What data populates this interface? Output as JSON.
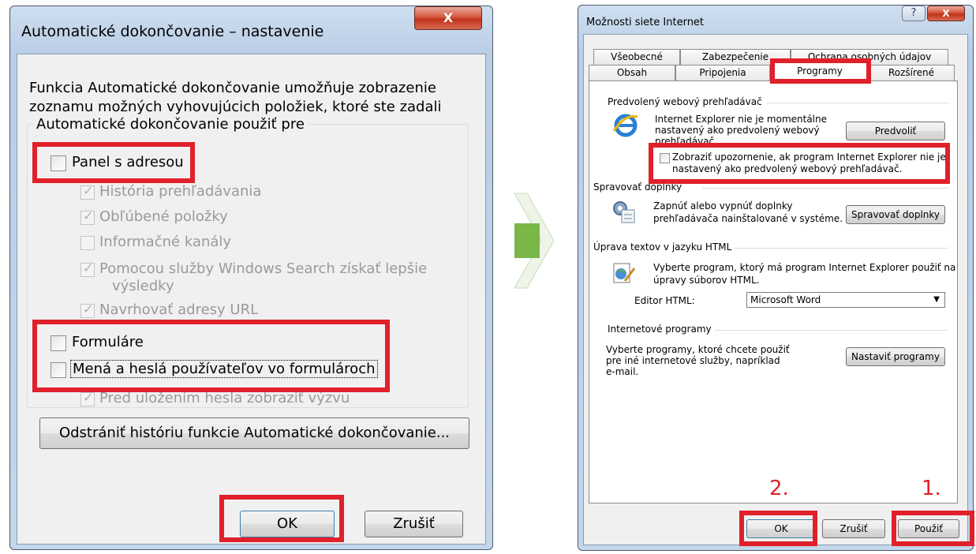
{
  "left_dialog": {
    "title": "Automatické dokončovanie – nastavenie",
    "close_label": "X",
    "description_line1": "Funkcia Automatické dokončovanie umožňuje zobrazenie",
    "description_line2": "zoznamu možných vyhovujúcich položiek, ktoré ste zadali",
    "group_title": "Automatické dokončovanie použiť pre",
    "options": [
      {
        "label": "Panel s adresou",
        "checked": false,
        "enabled": true
      },
      {
        "label": "História prehľadávania",
        "checked": true,
        "enabled": false
      },
      {
        "label": "Obľúbené položky",
        "checked": true,
        "enabled": false
      },
      {
        "label": "Informačné kanály",
        "checked": false,
        "enabled": false
      },
      {
        "label": "Pomocou služby Windows Search získať lepšie",
        "label2": "výsledky",
        "checked": true,
        "enabled": false
      },
      {
        "label": "Navrhovať adresy URL",
        "checked": true,
        "enabled": false
      },
      {
        "label": "Formuláre",
        "checked": false,
        "enabled": true
      },
      {
        "label": "Mená a heslá používateľov vo formulároch",
        "checked": false,
        "enabled": true
      },
      {
        "label": "Pred uložením hesla zobraziť výzvu",
        "checked": true,
        "enabled": false
      }
    ],
    "delete_history_label": "Odstrániť históriu funkcie Automatické dokončovanie...",
    "ok_label": "OK",
    "cancel_label": "Zrušiť"
  },
  "arrow_icon": "arrow-right-icon",
  "right_dialog": {
    "title": "Možnosti siete Internet",
    "help_label": "?",
    "close_label": "X",
    "tabs_row1": [
      "Všeobecné",
      "Zabezpečenie",
      "Ochrana osobných údajov"
    ],
    "tabs_row2": [
      "Obsah",
      "Pripojenia",
      "Programy",
      "Rozšírené"
    ],
    "active_tab": "Programy",
    "default_browser": {
      "group_title": "Predvolený webový prehľadávač",
      "text_line1": "Internet Explorer nie je momentálne",
      "text_line2": "nastavený ako predvolený webový",
      "text_line3": "prehľadávač.",
      "button_label": "Predvoliť",
      "warn_line1": "Zobraziť upozornenie, ak program Internet Explorer nie je",
      "warn_line2": "nastavený ako predvolený webový prehľadávač.",
      "icon": "ie-logo-icon"
    },
    "addons": {
      "group_title": "Spravovať doplnky",
      "text_line1": "Zapnúť alebo vypnúť doplnky",
      "text_line2": "prehľadávača nainštalované v systéme.",
      "button_label": "Spravovať doplnky",
      "icon": "addons-gear-icon"
    },
    "html_editing": {
      "group_title": "Úprava textov v jazyku HTML",
      "text_line1": "Vyberte program, ktorý má program Internet Explorer použiť na",
      "text_line2": "úpravy súborov HTML.",
      "editor_label": "Editor HTML:",
      "editor_value": "Microsoft Word",
      "icon": "html-editor-icon"
    },
    "internet_programs": {
      "group_title": "Internetové programy",
      "text_line1": "Vyberte programy, ktoré chcete použiť",
      "text_line2": "pre iné internetové služby, napríklad",
      "text_line3": "e-mail.",
      "button_label": "Nastaviť programy"
    },
    "ok_label": "OK",
    "cancel_label": "Zrušiť",
    "apply_label": "Použiť",
    "step1": "1.",
    "step2": "2."
  },
  "colors": {
    "highlight": "#e0202a",
    "arrow": "#7ab648"
  }
}
